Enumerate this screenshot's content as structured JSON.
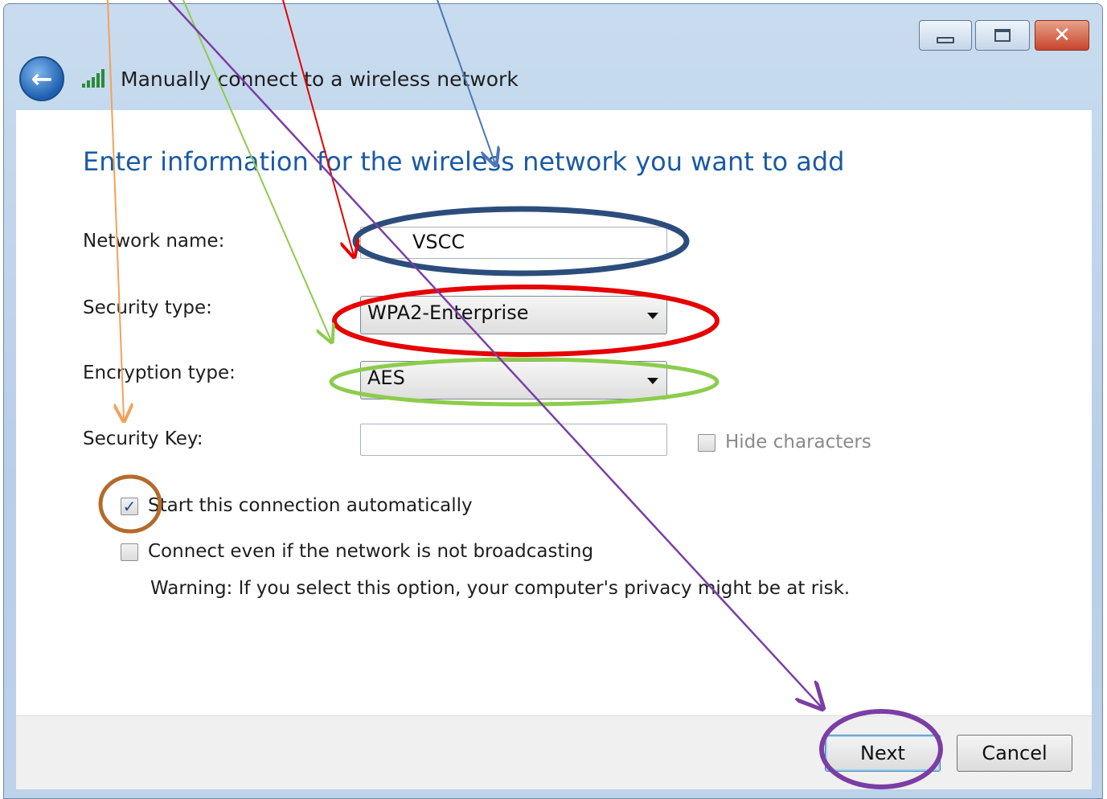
{
  "window": {
    "title": "Manually connect to a wireless network",
    "minimize_glyph": "",
    "close_glyph": "✕",
    "back_glyph": "←"
  },
  "heading": "Enter information for the wireless network you want to add",
  "form": {
    "network_name_label": "Network name:",
    "network_name_value": "VSCC",
    "security_type_label": "Security type:",
    "security_type_value": "WPA2-Enterprise",
    "encryption_type_label": "Encryption type:",
    "encryption_type_value": "AES",
    "security_key_label": "Security Key:",
    "security_key_value": "",
    "hide_characters_label": "Hide characters",
    "hide_characters_checked": false,
    "start_auto_label": "Start this connection automatically",
    "start_auto_checked": true,
    "connect_hidden_label": "Connect even if the network is not broadcasting",
    "connect_hidden_checked": false,
    "warning_text": "Warning: If you select this option, your computer's privacy might be at risk."
  },
  "buttons": {
    "next_label": "Next",
    "cancel_label": "Cancel"
  },
  "colors": {
    "heading": "#1a5aa6",
    "annotation_navy": "#2c4d7c",
    "annotation_red": "#e60000",
    "annotation_green": "#8ccc4c",
    "annotation_brown": "#b36b2b",
    "annotation_purple": "#7a3ea5",
    "annotation_orange": "#f2a25a",
    "annotation_blue": "#4d78b5"
  },
  "check_glyph": "✓"
}
